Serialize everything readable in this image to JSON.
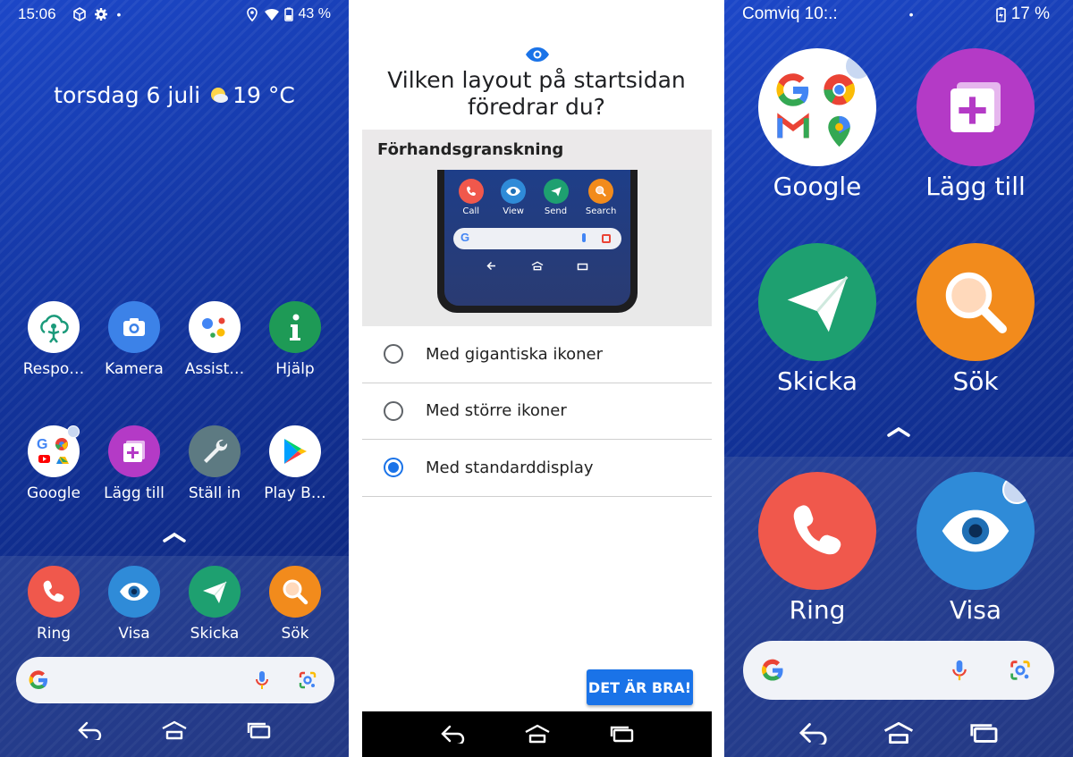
{
  "left": {
    "status": {
      "time": "15:06",
      "battery": "43 %"
    },
    "date_widget": {
      "date": "torsdag 6 juli",
      "temperature": "19 °C"
    },
    "apps_row1": [
      {
        "label": "Respo…",
        "icon": "respond-icon"
      },
      {
        "label": "Kamera",
        "icon": "camera-icon"
      },
      {
        "label": "Assist…",
        "icon": "assistant-icon"
      },
      {
        "label": "Hjälp",
        "icon": "help-icon"
      }
    ],
    "apps_row2": [
      {
        "label": "Google",
        "icon": "google-folder-icon"
      },
      {
        "label": "Lägg till",
        "icon": "add-icon"
      },
      {
        "label": "Ställ in",
        "icon": "wrench-icon"
      },
      {
        "label": "Play B…",
        "icon": "play-store-icon"
      }
    ],
    "dock": [
      {
        "label": "Ring",
        "icon": "phone-icon"
      },
      {
        "label": "Visa",
        "icon": "eye-icon"
      },
      {
        "label": "Skicka",
        "icon": "send-icon"
      },
      {
        "label": "Sök",
        "icon": "search-icon"
      }
    ]
  },
  "middle": {
    "heading_line1": "Vilken layout på startsidan",
    "heading_line2": "föredrar du?",
    "preview_title": "Förhandsgranskning",
    "preview_apps": [
      "Call",
      "View",
      "Send",
      "Search"
    ],
    "options": [
      {
        "label": "Med gigantiska ikoner",
        "selected": false
      },
      {
        "label": "Med större ikoner",
        "selected": false
      },
      {
        "label": "Med standarddisplay",
        "selected": true
      }
    ],
    "ok_button": "DET ÄR BRA!"
  },
  "right": {
    "status": {
      "carrier": "Comviq 10:.:",
      "battery": "17 %"
    },
    "apps": [
      {
        "label": "Google",
        "icon": "google-folder-icon"
      },
      {
        "label": "Lägg till",
        "icon": "add-icon"
      },
      {
        "label": "Skicka",
        "icon": "send-icon"
      },
      {
        "label": "Sök",
        "icon": "search-icon"
      }
    ],
    "dock": [
      {
        "label": "Ring",
        "icon": "phone-icon"
      },
      {
        "label": "Visa",
        "icon": "eye-icon"
      }
    ]
  },
  "colors": {
    "accent": "#1a73e8",
    "home_background": "#13349a",
    "call": "#f0584c",
    "view": "#2f8bd8",
    "send": "#1ea070",
    "search": "#f28b1c",
    "add": "#b43ac6"
  }
}
